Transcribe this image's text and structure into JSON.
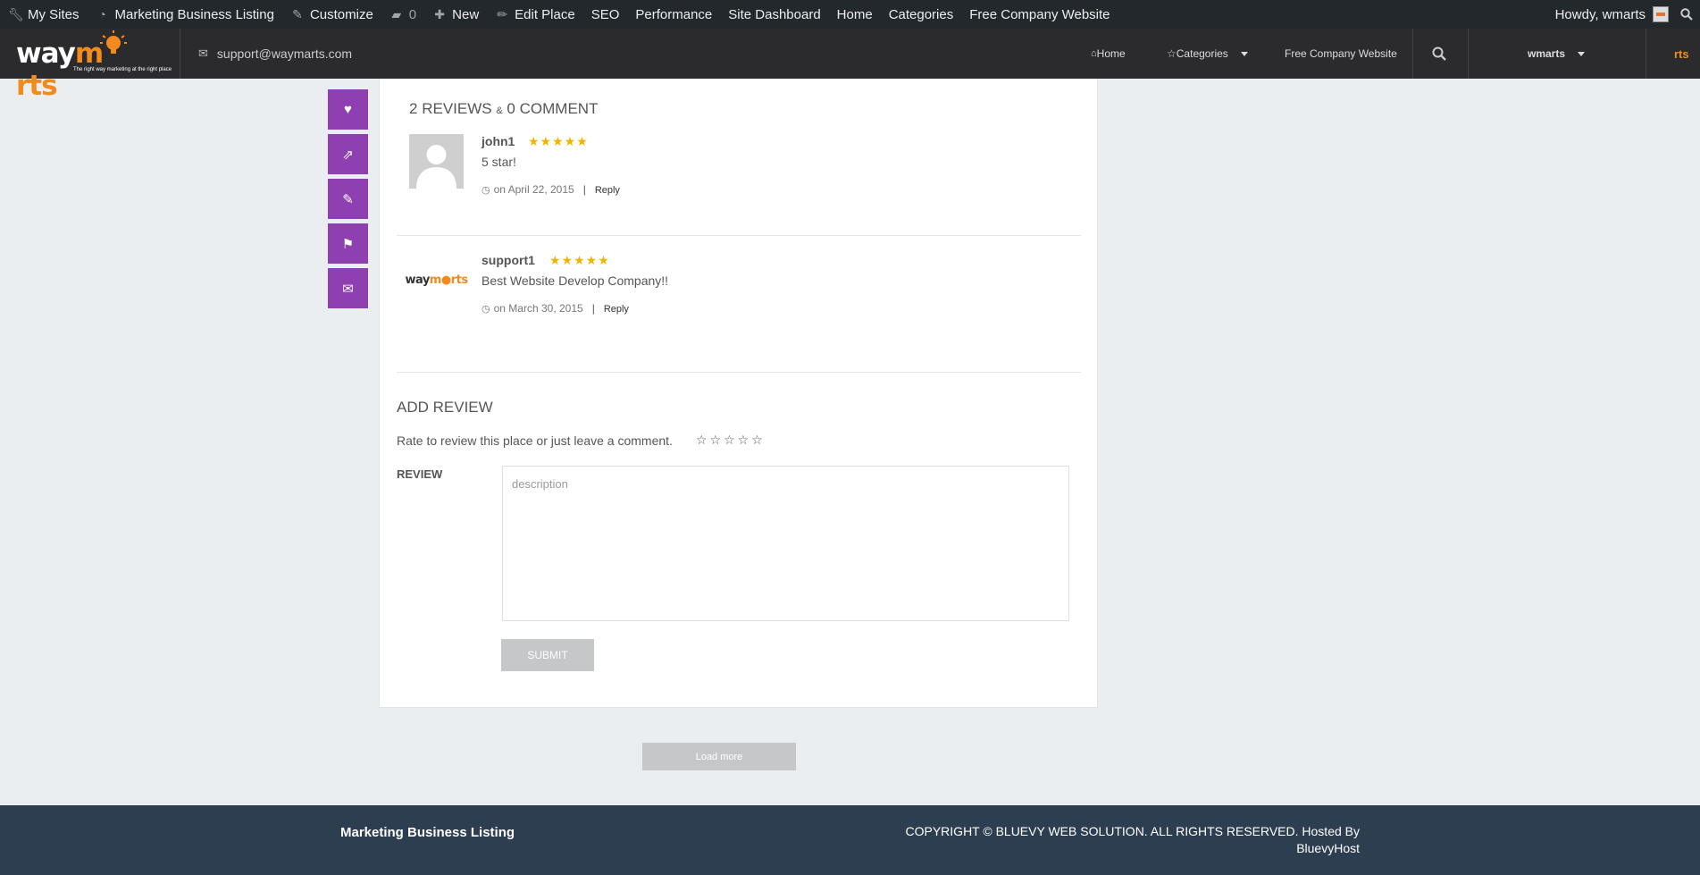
{
  "admin_bar": {
    "items": [
      {
        "label": "My Sites",
        "icon": "wrench-icon"
      },
      {
        "label": "Marketing Business Listing",
        "icon": "dashboard-icon"
      },
      {
        "label": "Customize",
        "icon": "brush-icon"
      },
      {
        "label": "0",
        "icon": "comment-icon"
      },
      {
        "label": "New",
        "icon": "plus-icon"
      },
      {
        "label": "Edit Place",
        "icon": "pencil-icon"
      },
      {
        "label": "SEO",
        "icon": ""
      },
      {
        "label": "Performance",
        "icon": ""
      },
      {
        "label": "Site Dashboard",
        "icon": ""
      },
      {
        "label": "Home",
        "icon": ""
      },
      {
        "label": "Categories",
        "icon": ""
      },
      {
        "label": "Free Company Website",
        "icon": ""
      }
    ],
    "howdy": "Howdy, wmarts"
  },
  "header": {
    "logo_text_1": "way",
    "logo_text_2": "m",
    "logo_text_3": "rts",
    "logo_tagline": "The right way marketing at the right place",
    "email": "support@waymarts.com",
    "nav_home": "Home",
    "nav_categories": "Categories",
    "nav_free": "Free Company Website",
    "user": "wmarts"
  },
  "reviews": {
    "count": "2",
    "reviews_word": "REVIEWS",
    "amp": "&",
    "comment_count": "0",
    "comment_word": "COMMENT",
    "items": [
      {
        "author": "john1",
        "stars": "★★★★★",
        "text": "5 star!",
        "date": "on April 22, 2015",
        "reply": "Reply"
      },
      {
        "author": "support1",
        "stars": "★★★★★",
        "text": "Best Website Develop Company!!",
        "date": "on March 30, 2015",
        "reply": "Reply"
      }
    ]
  },
  "add_review": {
    "title": "ADD REVIEW",
    "prompt": "Rate to review this place or just leave a comment.",
    "empty_stars": "☆☆☆☆☆",
    "label": "REVIEW",
    "placeholder": "description",
    "submit": "SUBMIT"
  },
  "load_more": "Load more",
  "footer": {
    "brand": "Marketing Business Listing",
    "copyright_line1": "COPYRIGHT © BLUEVY WEB SOLUTION. ALL RIGHTS RESERVED. Hosted By",
    "copyright_line2": "BluevyHost"
  },
  "colors": {
    "accent_purple": "#8e3fb0",
    "star_gold": "#f0b400",
    "footer_bg": "#2d3e50",
    "admin_bar_bg": "#23282d"
  }
}
